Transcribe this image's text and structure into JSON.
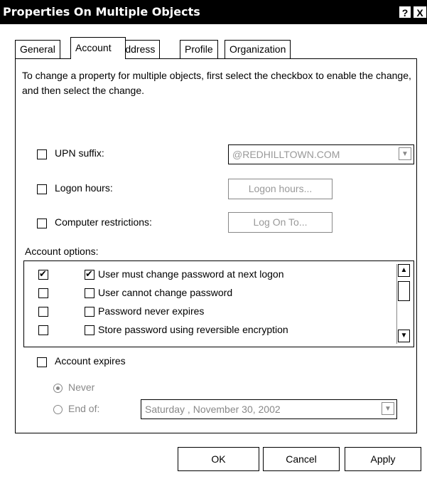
{
  "window": {
    "title": "Properties On Multiple Objects",
    "help_label": "?",
    "close_label": "X"
  },
  "tabs": [
    {
      "label": "General",
      "active": false
    },
    {
      "label": "Account",
      "active": true
    },
    {
      "label": "Address",
      "active": false
    },
    {
      "label": "Profile",
      "active": false
    },
    {
      "label": "Organization",
      "active": false
    }
  ],
  "instructions": "To change a property for multiple objects, first select the checkbox to enable the change, and then select the change.",
  "upn": {
    "label": "UPN suffix:",
    "checked": false,
    "value": "@REDHILLTOWN.COM"
  },
  "logon_hours": {
    "label": "Logon hours:",
    "checked": false,
    "button": "Logon hours..."
  },
  "computer_restrictions": {
    "label": "Computer restrictions:",
    "checked": false,
    "button": "Log On To..."
  },
  "account_options": {
    "label": "Account options:",
    "items": [
      {
        "enable_checked": true,
        "option_checked": true,
        "label": "User must change password at next logon"
      },
      {
        "enable_checked": false,
        "option_checked": false,
        "label": "User cannot change password"
      },
      {
        "enable_checked": false,
        "option_checked": false,
        "label": "Password never expires"
      },
      {
        "enable_checked": false,
        "option_checked": false,
        "label": "Store password using reversible encryption"
      }
    ]
  },
  "account_expires": {
    "label": "Account expires",
    "checked": false,
    "never_label": "Never",
    "end_of_label": "End of:",
    "selected": "Never",
    "date_value": "Saturday , November 30, 2002"
  },
  "buttons": {
    "ok": "OK",
    "cancel": "Cancel",
    "apply": "Apply"
  }
}
